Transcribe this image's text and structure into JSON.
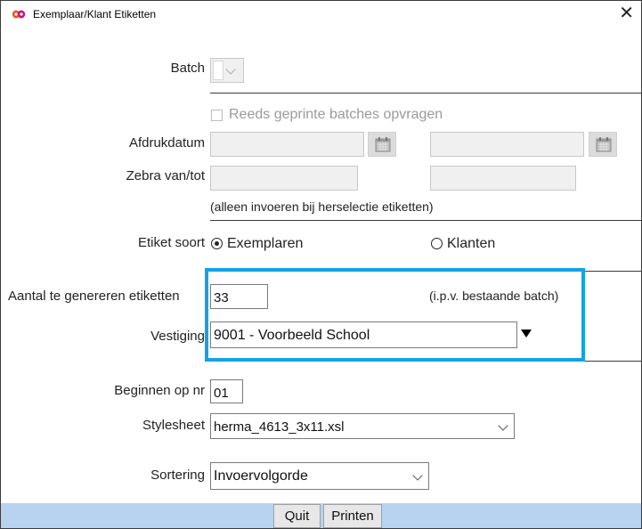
{
  "window": {
    "title": "Exemplaar/Klant Etiketten",
    "close_glyph": "✕",
    "icon": "app-logo-icon"
  },
  "batch": {
    "label": "Batch"
  },
  "reprint": {
    "label": "Reeds geprinte batches opvragen"
  },
  "afdrukdatum": {
    "label": "Afdrukdatum",
    "from": "",
    "to": ""
  },
  "zebra": {
    "label": "Zebra van/tot",
    "from": "",
    "to": ""
  },
  "herselectie_note": "(alleen invoeren bij herselectie etiketten)",
  "etiket_soort": {
    "label": "Etiket soort",
    "options": [
      {
        "label": "Exemplaren",
        "selected": true
      },
      {
        "label": "Klanten",
        "selected": false
      }
    ]
  },
  "aantal": {
    "label": "Aantal te genereren etiketten",
    "value": "33",
    "note": "(i.p.v. bestaande batch)"
  },
  "vestiging": {
    "label": "Vestiging",
    "value": "9001 - Voorbeeld School"
  },
  "beginnen": {
    "label": "Beginnen op nr",
    "value": "01"
  },
  "stylesheet": {
    "label": "Stylesheet",
    "value": "herma_4613_3x11.xsl"
  },
  "sortering": {
    "label": "Sortering",
    "value": "Invoervolgorde"
  },
  "buttons": {
    "quit": "Quit",
    "printen": "Printen"
  },
  "colors": {
    "highlight": "#12a3e0",
    "footer": "#b8d3f0"
  }
}
